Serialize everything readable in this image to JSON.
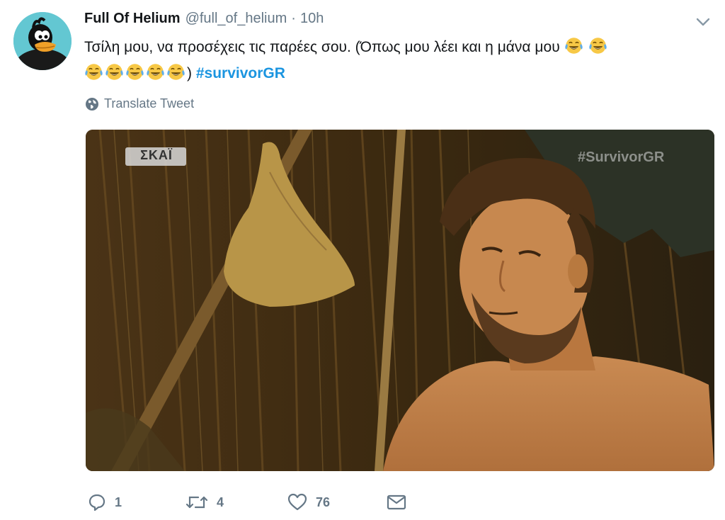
{
  "tweet": {
    "display_name": "Full Of Helium",
    "handle": "@full_of_helium",
    "separator": "·",
    "time": "10h",
    "text_part1": "Τσίλη μου, να προσέχεις τις παρέες σου. (Όπως μου λέει και η μάνα μου",
    "text_part2": ")",
    "hashtag": "#survivorGR",
    "emoji_name": "face-with-tears-of-joy",
    "translate_label": "Translate Tweet"
  },
  "media": {
    "channel_logo": "ΣΚΑΪ",
    "watermark": "#SurvivorGR"
  },
  "actions": {
    "reply_count": "1",
    "retweet_count": "4",
    "like_count": "76"
  },
  "colors": {
    "link": "#1b95e0",
    "secondary": "#657786",
    "text": "#14171a"
  }
}
